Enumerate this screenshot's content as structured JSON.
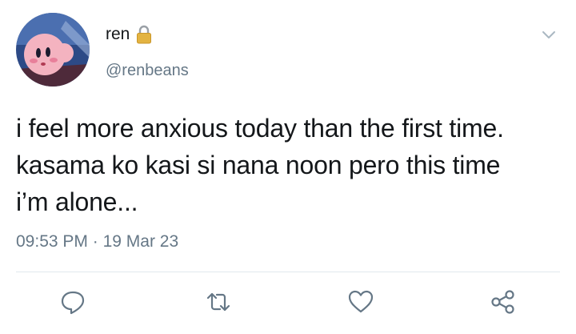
{
  "author": {
    "display_name": "ren",
    "handle": "@renbeans",
    "protected_icon": "lock-icon",
    "avatar_icon": "kirby-avatar"
  },
  "tweet": {
    "lines": [
      "i feel more anxious today than the first time.",
      "kasama ko kasi si nana noon pero this time",
      "i’m alone..."
    ],
    "time": "09:53 PM",
    "separator": "·",
    "date": "19 Mar 23"
  },
  "actions": [
    "reply-icon",
    "retweet-icon",
    "like-icon",
    "share-icon"
  ],
  "colors": {
    "text": "#14171a",
    "secondary": "#657786",
    "icon": "#657786",
    "divider": "#e1e8ed"
  }
}
